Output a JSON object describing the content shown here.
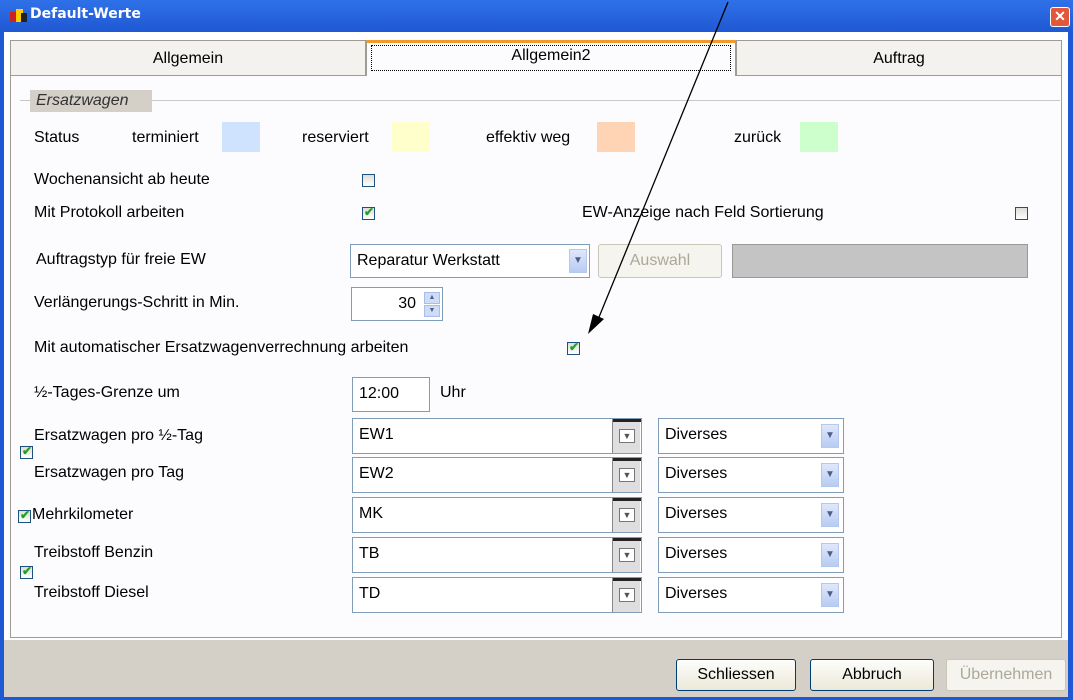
{
  "window": {
    "title": "Default-Werte",
    "close_glyph": "✕"
  },
  "tabs": [
    {
      "label": "Allgemein",
      "active": false
    },
    {
      "label": "Allgemein2",
      "active": true
    },
    {
      "label": "Auftrag",
      "active": false
    }
  ],
  "group": {
    "title": "Ersatzwagen"
  },
  "status": {
    "label": "Status",
    "items": [
      {
        "label": "terminiert",
        "color": "#cfe3ff"
      },
      {
        "label": "reserviert",
        "color": "#ffffcc"
      },
      {
        "label": "effektiv weg",
        "color": "#fed4b4"
      },
      {
        "label": "zurück",
        "color": "#ccffcc"
      }
    ]
  },
  "options": {
    "wochenansicht": {
      "label": "Wochenansicht ab heute",
      "checked": false
    },
    "protokoll": {
      "label": "Mit Protokoll arbeiten",
      "checked": true
    },
    "ew_sort": {
      "label": "EW-Anzeige nach Feld Sortierung",
      "checked": false
    },
    "auto_verrechnung": {
      "label": "Mit automatischer Ersatzwagenverrechnung arbeiten",
      "checked": true
    }
  },
  "auftragstyp": {
    "label": "Auftragstyp für freie EW",
    "value": "Reparatur Werkstatt",
    "button": "Auswahl"
  },
  "verlaengerung": {
    "label": "Verlängerungs-Schritt in Min.",
    "value": "30"
  },
  "halbtag": {
    "label": "½-Tages-Grenze um",
    "value": "12:00",
    "unit": "Uhr"
  },
  "articles": [
    {
      "label": "Ersatzwagen pro  ½-Tag",
      "code": "EW1",
      "category": "Diverses"
    },
    {
      "label": "Ersatzwagen pro Tag",
      "code": "EW2",
      "category": "Diverses"
    },
    {
      "label": "Mehrkilometer",
      "code": "MK",
      "category": "Diverses"
    },
    {
      "label": "Treibstoff Benzin",
      "code": "TB",
      "category": "Diverses"
    },
    {
      "label": "Treibstoff Diesel",
      "code": "TD",
      "category": "Diverses"
    }
  ],
  "footer": {
    "close": "Schliessen",
    "cancel": "Abbruch",
    "apply": "Übernehmen"
  },
  "icons": {
    "checkbox_tick": "✔",
    "combo_arrow": "▼",
    "spin_up": "▲",
    "spin_down": "▼",
    "lookup": "▼"
  }
}
